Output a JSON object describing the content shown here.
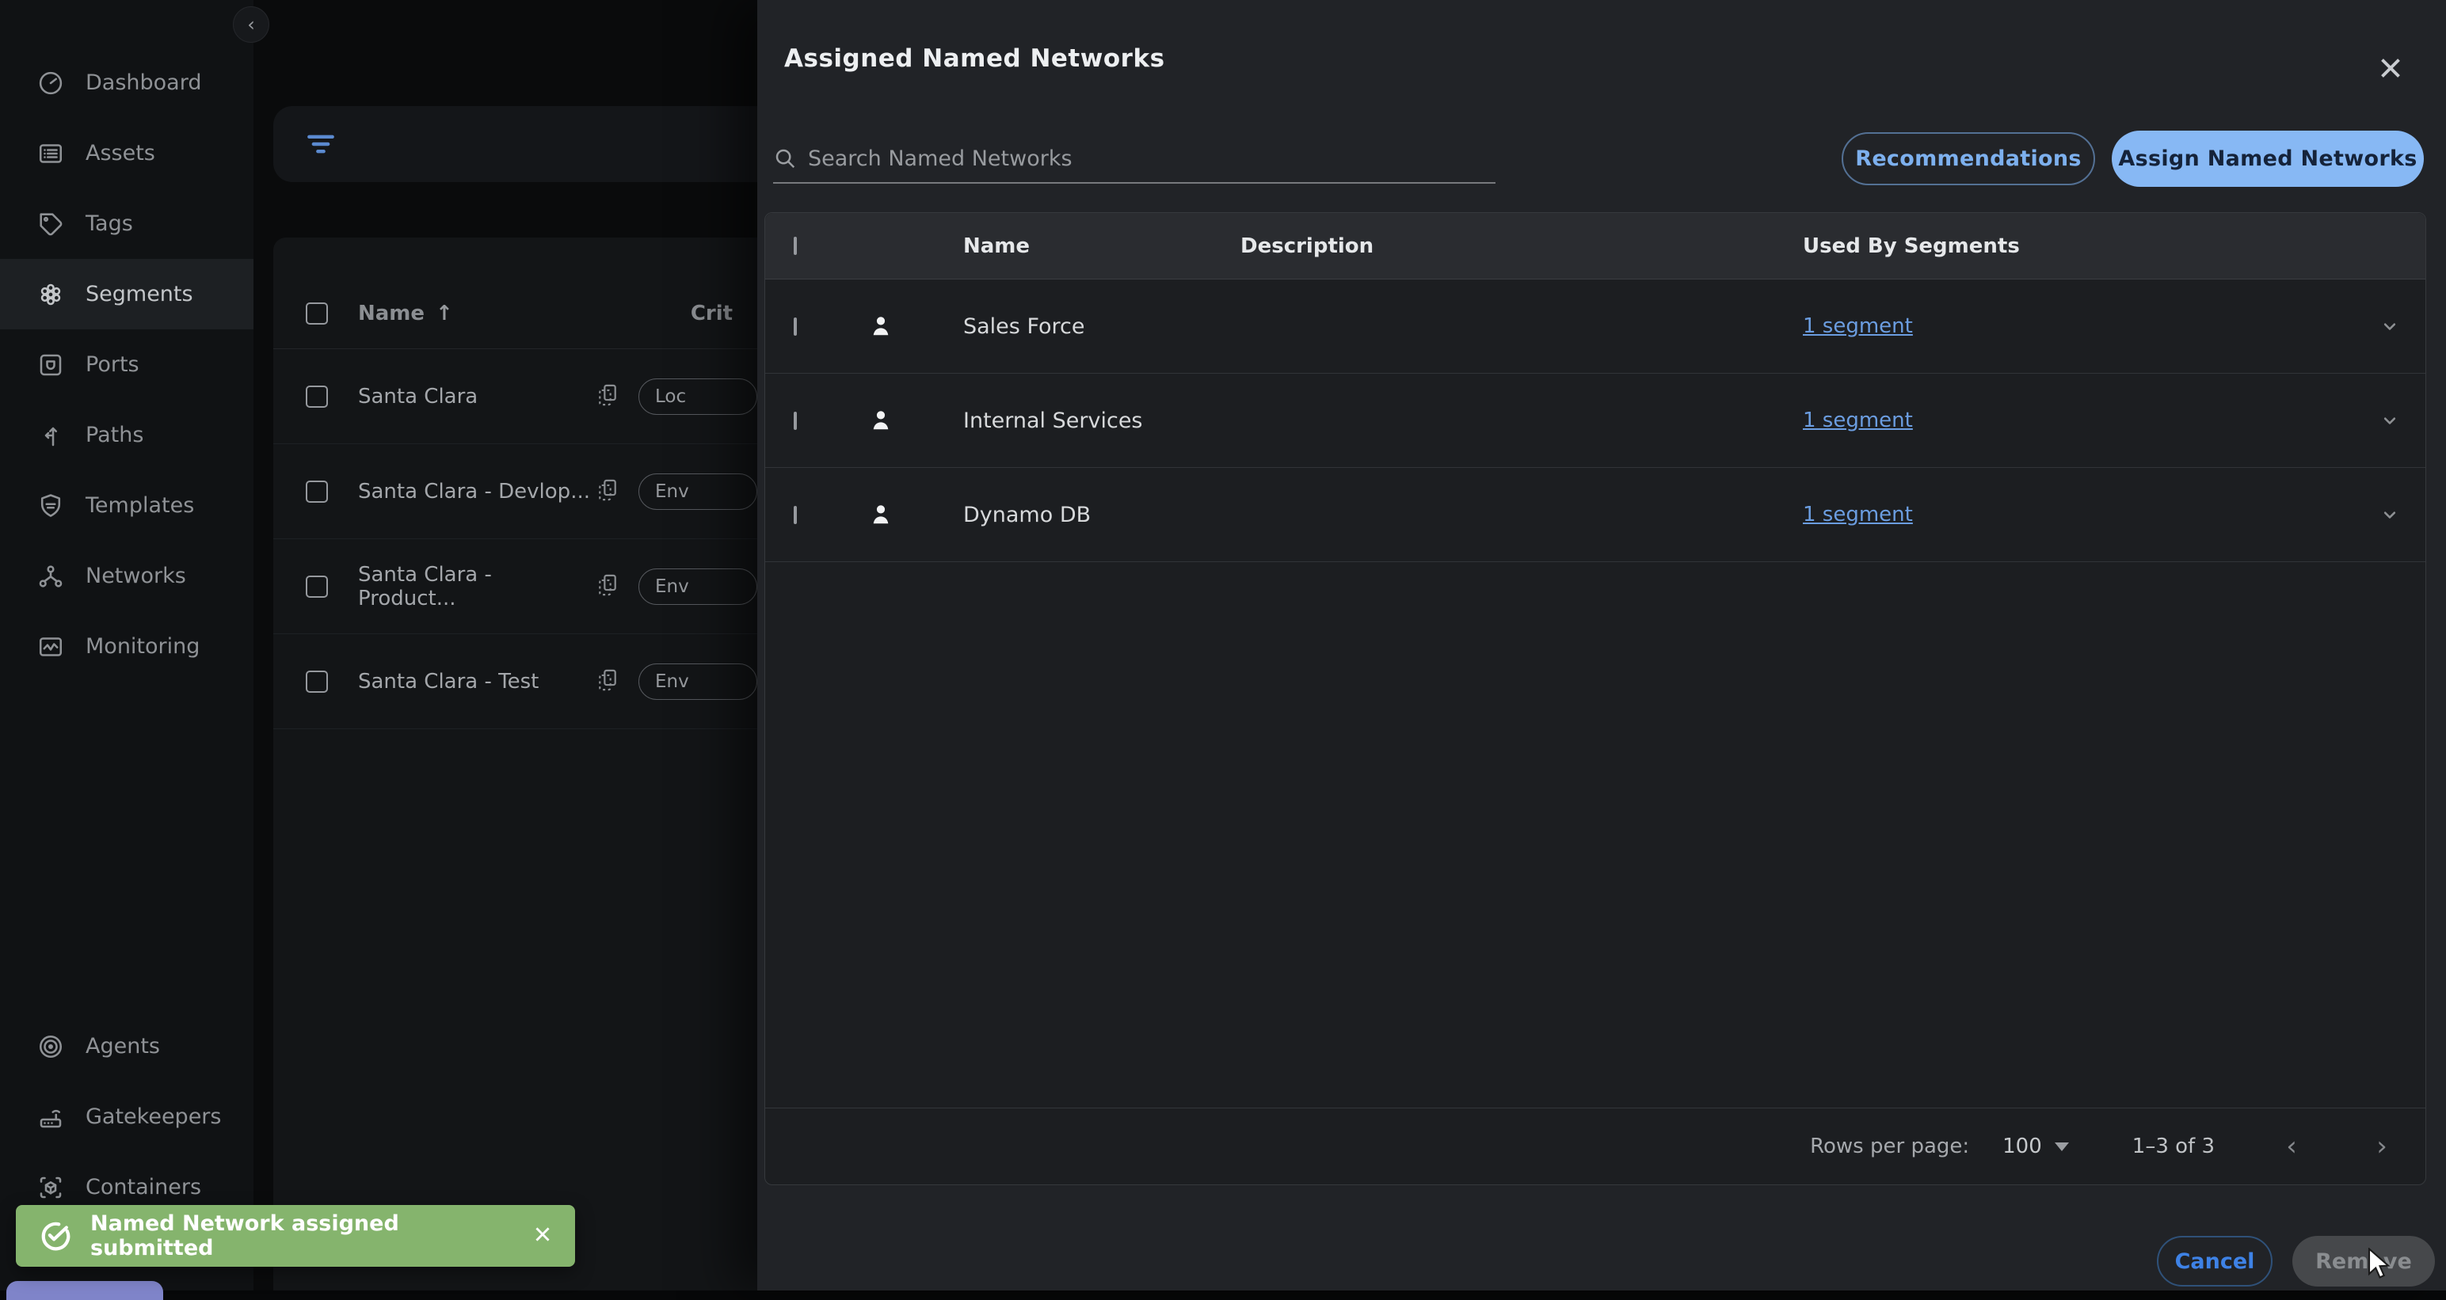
{
  "colors": {
    "accent_blue": "#87b8f4",
    "link_blue": "#6b9de0",
    "cancel_blue": "#3e82e6",
    "toast_green": "#85b46d",
    "drawer_bg": "#212327",
    "card_bg": "#1c1e21",
    "sidebar_bg": "#101214"
  },
  "sidebar": {
    "collapse": "‹",
    "items": [
      {
        "label": "Dashboard",
        "active": false
      },
      {
        "label": "Assets",
        "active": false
      },
      {
        "label": "Tags",
        "active": false
      },
      {
        "label": "Segments",
        "active": true
      },
      {
        "label": "Ports",
        "active": false
      },
      {
        "label": "Paths",
        "active": false
      },
      {
        "label": "Templates",
        "active": false
      },
      {
        "label": "Networks",
        "active": false
      },
      {
        "label": "Monitoring",
        "active": false
      }
    ],
    "footer_items": [
      {
        "label": "Agents"
      },
      {
        "label": "Gatekeepers"
      },
      {
        "label": "Containers"
      }
    ]
  },
  "background": {
    "table": {
      "sort_header": "Name",
      "sort_direction": "↑",
      "second_header": "Crit",
      "rows": [
        {
          "name": "Santa Clara",
          "chip": "Loc"
        },
        {
          "name": "Santa Clara - Devlop...",
          "chip": "Env"
        },
        {
          "name": "Santa Clara - Product...",
          "chip": "Env"
        },
        {
          "name": "Santa Clara - Test",
          "chip": "Env"
        }
      ]
    }
  },
  "modal": {
    "title": "Assigned Named Networks",
    "search_placeholder": "Search Named Networks",
    "buttons": {
      "recommendations": "Recommendations",
      "assign": "Assign Named Networks"
    },
    "table": {
      "headers": {
        "name": "Name",
        "description": "Description",
        "used_by": "Used By Segments"
      },
      "rows": [
        {
          "name": "Sales Force",
          "description": "",
          "used_by": "1 segment"
        },
        {
          "name": "Internal Services",
          "description": "",
          "used_by": "1 segment"
        },
        {
          "name": "Dynamo DB",
          "description": "",
          "used_by": "1 segment"
        }
      ]
    },
    "footer": {
      "rows_per_page_label": "Rows per page:",
      "rows_per_page_value": "100",
      "range": "1–3 of 3",
      "prev": "‹",
      "next": "›"
    },
    "actions": {
      "cancel": "Cancel",
      "remove": "Remove"
    }
  },
  "toast": {
    "message": "Named Network assigned submitted"
  }
}
